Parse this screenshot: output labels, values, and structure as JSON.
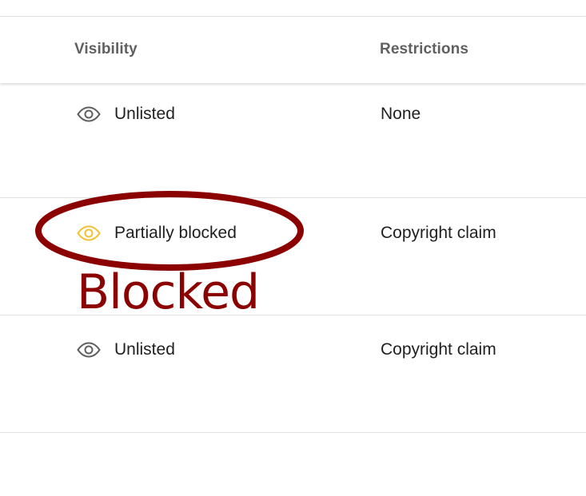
{
  "table": {
    "headers": {
      "visibility": "Visibility",
      "restrictions": "Restrictions"
    },
    "rows": [
      {
        "visibility": "Unlisted",
        "visibility_icon": "eye-icon",
        "icon_color": "#606060",
        "restrictions": "None"
      },
      {
        "visibility": "Partially blocked",
        "visibility_icon": "eye-icon",
        "icon_color": "#f2c232",
        "restrictions": "Copyright claim"
      },
      {
        "visibility": "Unlisted",
        "visibility_icon": "eye-icon",
        "icon_color": "#606060",
        "restrictions": "Copyright claim"
      }
    ]
  },
  "annotation": {
    "text": "Blocked",
    "color": "#8b0000"
  }
}
